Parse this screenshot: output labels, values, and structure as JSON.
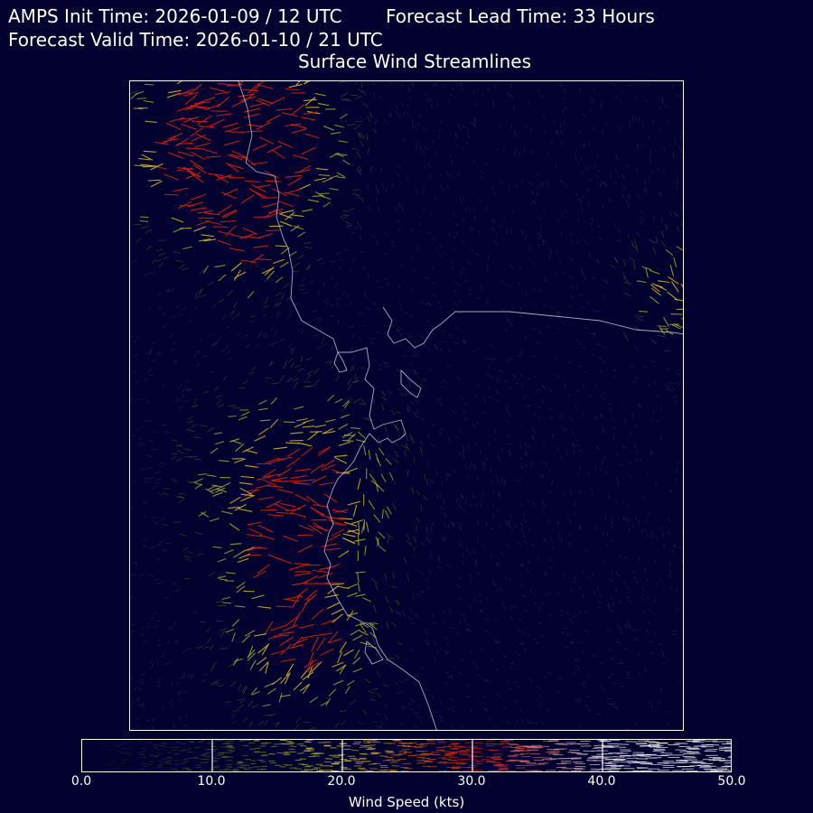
{
  "header": {
    "init_time": "AMPS Init Time: 2026-01-09 / 12 UTC",
    "lead_time": "Forecast Lead Time: 33 Hours",
    "valid_time": "Forecast Valid Time: 2026-01-10 / 21 UTC",
    "title": "Surface Wind Streamlines"
  },
  "colorbar": {
    "label": "Wind Speed (kts)",
    "ticks": [
      "0.0",
      "10.0",
      "20.0",
      "30.0",
      "40.0",
      "50.0"
    ],
    "min": 0,
    "max": 50,
    "colors": [
      "#02002e",
      "#556b1a",
      "#d8d81a",
      "#c81010",
      "#ffffff"
    ]
  },
  "map": {
    "background": "#02002e",
    "coastline_color": "#c8c8d8",
    "streamline_color_low": "#3a4a6a",
    "streamline_color_high": "#d8d81a"
  }
}
